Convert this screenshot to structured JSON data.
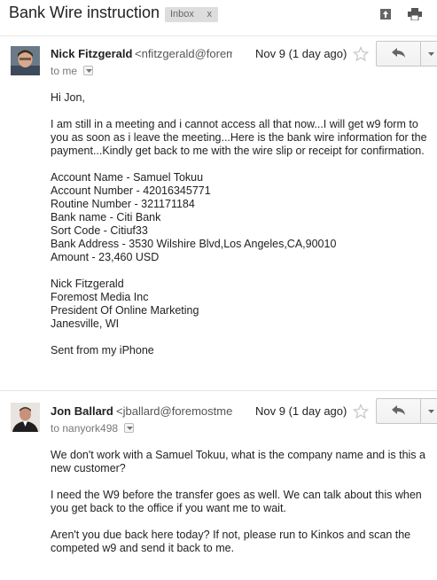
{
  "thread": {
    "subject": "Bank Wire instruction",
    "label": "Inbox",
    "label_remove": "x"
  },
  "messages": [
    {
      "sender": "Nick Fitzgerald",
      "email": "<nfitzgerald@foremostmediainc.com>",
      "date": "Nov 9 (1 day ago)",
      "to": "to me",
      "body": {
        "greeting": "Hi Jon,",
        "para1": "I am still in a meeting and i cannot access all that now...I will get w9 form to you as soon as i leave the meeting...Here is the bank wire information for the payment...Kindly get back to me with the wire slip or receipt for confirmation.",
        "details": [
          "Account Name - Samuel Tokuu",
          "Account Number - 42016345771",
          "Routine Number - 321171184",
          "Bank name - Citi Bank",
          "Sort Code - Citiuf33",
          "Bank Address - 3530 Wilshire Blvd,Los Angeles,CA,90010",
          "Amount - 23,460 USD"
        ],
        "signature": [
          "Nick Fitzgerald",
          "Foremost Media Inc",
          "President Of Online Marketing",
          "Janesville,  WI"
        ],
        "footer": "Sent from my iPhone"
      }
    },
    {
      "sender": "Jon Ballard",
      "email": "<jballard@foremostmediainc.com>",
      "date": "Nov 9 (1 day ago)",
      "to": "to nanyork498",
      "body": {
        "para1": "We don't work with a Samuel Tokuu, what is the company name and is this a new customer?",
        "para2": "I need the W9 before the transfer goes as well.  We can talk about this when you get back to the office if you want me to wait.",
        "para3": "Aren't you due back here today?  If not, please run to Kinkos and scan the competed w9 and send it back to me."
      }
    }
  ],
  "icons": {
    "archive": "archive-icon",
    "print": "print-icon",
    "star": "star-icon",
    "reply": "reply-icon",
    "more": "chevron-down-icon"
  }
}
